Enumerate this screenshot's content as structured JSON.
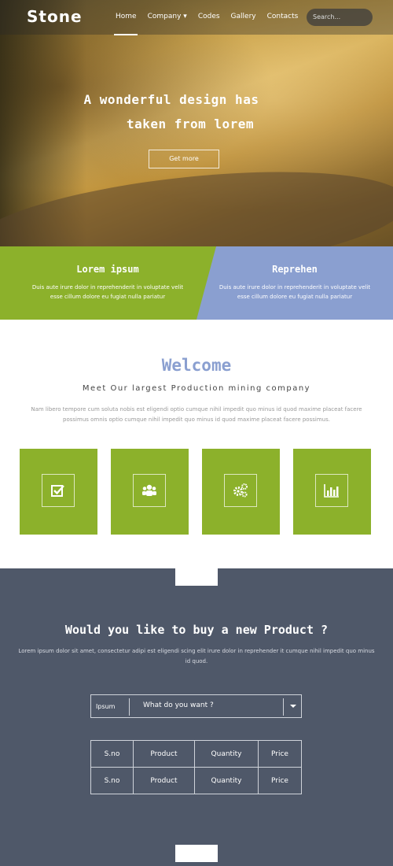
{
  "header": {
    "logo": "Stone",
    "nav": [
      "Home",
      "Company",
      "Codes",
      "Gallery",
      "Contacts"
    ],
    "search_placeholder": "Search..."
  },
  "hero": {
    "title_line1": "A wonderful design has",
    "title_line2": "taken from lorem",
    "button": "Get more"
  },
  "bands": [
    {
      "title": "Lorem ipsum",
      "text_line1": "Duis aute irure dolor in reprehenderit in voluptate velit",
      "text_line2": "esse cillum dolore eu fugiat nulla pariatur",
      "color": "#8cb12b"
    },
    {
      "title": "Reprehen",
      "text_line1": "Duis aute irure dolor in reprehenderit in voluptate velit",
      "text_line2": "esse cillum dolore eu fugiat nulla pariatur",
      "color": "#8a9fd0"
    }
  ],
  "welcome": {
    "title": "Welcome",
    "subtitle": "Meet Our largest Production mining company",
    "text": "Nam libero tempore cum soluta nobis est eligendi optio cumque nihil impedit quo minus id quod maxime placeat facere possimus omnis optio cumque nihil impedit quo minus id quod maxime placeat facere possimus."
  },
  "tiles": [
    {
      "icon": "checkbox-icon"
    },
    {
      "icon": "users-icon"
    },
    {
      "icon": "gears-icon"
    },
    {
      "icon": "bar-chart-icon"
    }
  ],
  "buy": {
    "title": "Would you like to buy a new Product ?",
    "text": "Lorem ipsum dolor sit amet, consectetur adipi est eligendi scing elit irure dolor in reprehender it cumque nihil impedit quo minus id quod.",
    "select_label": "Ipsum",
    "select_value": "What do you want ?",
    "table": [
      [
        "S.no",
        "Product",
        "Quantity",
        "Price"
      ],
      [
        "S.no",
        "Product",
        "Quantity",
        "Price"
      ]
    ]
  },
  "colors": {
    "accent_green": "#8cb12b",
    "accent_blue": "#8a9fd0",
    "dark_section": "#4f5869"
  }
}
